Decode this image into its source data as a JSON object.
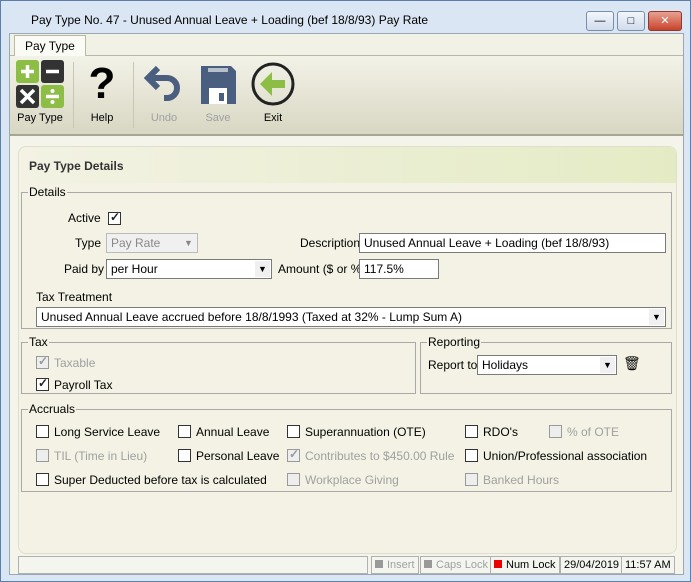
{
  "window": {
    "title": "Pay Type No. 47 - Unused Annual Leave + Loading (bef 18/8/93) Pay Rate",
    "minimize": "—",
    "maximize": "□",
    "close": "✕"
  },
  "tab": "Pay Type",
  "toolbar": {
    "paytype": "Pay Type",
    "help": "Help",
    "undo": "Undo",
    "save": "Save",
    "exit": "Exit"
  },
  "panel_title": "Pay Type Details",
  "details": {
    "legend": "Details",
    "active_label": "Active",
    "active": true,
    "type_label": "Type",
    "type_value": "Pay Rate",
    "description_label": "Description",
    "description_value": "Unused Annual Leave + Loading (bef 18/8/93)",
    "paidby_label": "Paid by",
    "paidby_value": "per Hour",
    "amount_label": "Amount ($ or %)",
    "amount_value": "117.5%",
    "tax_treatment_label": "Tax Treatment",
    "tax_treatment_value": "Unused Annual Leave accrued before 18/8/1993 (Taxed at 32% - Lump Sum A)"
  },
  "tax": {
    "legend": "Tax",
    "taxable": "Taxable",
    "payroll_tax": "Payroll Tax"
  },
  "reporting": {
    "legend": "Reporting",
    "report_to_label": "Report to",
    "report_to_value": "Holidays"
  },
  "accruals": {
    "legend": "Accruals",
    "items": [
      {
        "label": "Long Service Leave",
        "checked": false,
        "disabled": false
      },
      {
        "label": "Annual Leave",
        "checked": false,
        "disabled": false
      },
      {
        "label": "Superannuation (OTE)",
        "checked": false,
        "disabled": false
      },
      {
        "label": "RDO's",
        "checked": false,
        "disabled": false
      },
      {
        "label": "% of OTE",
        "checked": false,
        "disabled": true
      },
      {
        "label": "TIL (Time in Lieu)",
        "checked": false,
        "disabled": true
      },
      {
        "label": "Personal Leave",
        "checked": false,
        "disabled": false
      },
      {
        "label": "Contributes to $450.00 Rule",
        "checked": true,
        "disabled": true
      },
      {
        "label": "Union/Professional association",
        "checked": false,
        "disabled": false
      },
      {
        "label": "Super Deducted before tax is calculated",
        "checked": false,
        "disabled": false
      },
      {
        "label": "Workplace Giving",
        "checked": false,
        "disabled": true
      },
      {
        "label": "Banked Hours",
        "checked": false,
        "disabled": true
      }
    ]
  },
  "status": {
    "insert": "Insert",
    "caps": "Caps Lock",
    "num": "Num Lock",
    "date": "29/04/2019",
    "time": "11:57 AM"
  }
}
